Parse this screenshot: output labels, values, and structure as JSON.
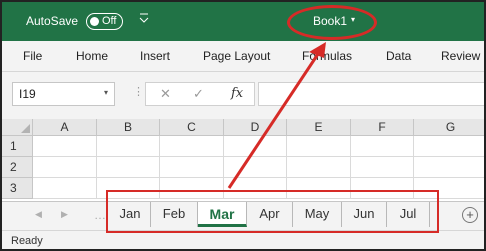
{
  "titlebar": {
    "autosave_label": "AutoSave",
    "autosave_state": "Off",
    "qat_icon": "customize-quick-access-icon",
    "workbook_title": "Book1",
    "title_caret": "▾",
    "bg_color": "#217346"
  },
  "menu": {
    "items": [
      "File",
      "Home",
      "Insert",
      "Page Layout",
      "Formulas",
      "Data",
      "Review"
    ]
  },
  "formula_bar": {
    "name_box_value": "I19",
    "name_box_caret": "▾",
    "separator": "⋮",
    "cancel_icon": "✕",
    "enter_icon": "✓",
    "fx_label": "fx",
    "formula_value": ""
  },
  "grid": {
    "columns": [
      "A",
      "B",
      "C",
      "D",
      "E",
      "F",
      "G"
    ],
    "rows": [
      "1",
      "2",
      "3"
    ]
  },
  "sheet_tabs": {
    "prev_icon": "◀",
    "next_icon": "▶",
    "dots": "…",
    "tabs": [
      "Jan",
      "Feb",
      "Mar",
      "Apr",
      "May",
      "Jun",
      "Jul"
    ],
    "active_tab": "Mar",
    "add_sheet_icon": "+"
  },
  "status": {
    "text": "Ready"
  },
  "annotation": {
    "color": "#d62b27"
  }
}
